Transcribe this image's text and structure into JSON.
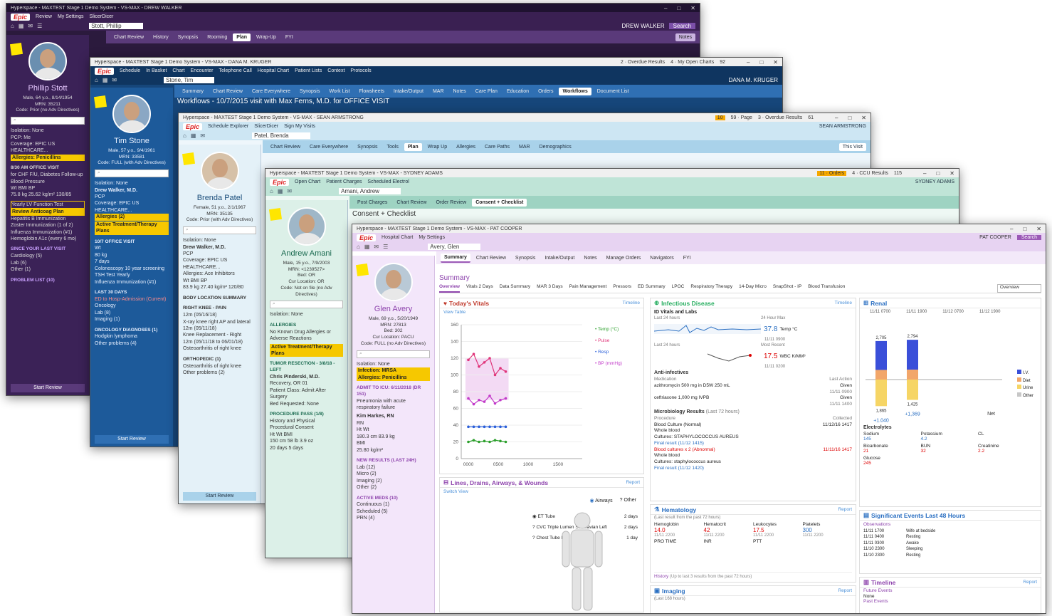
{
  "win1": {
    "title": "Hyperspace - MAXTEST Stage 1 Demo System - VS-MAX - DREW WALKER",
    "menu": [
      "Epic",
      "Review",
      "My Settings",
      "SlicerDicer"
    ],
    "patient_tab": "Stott, Phillip",
    "tabs": [
      "Chart Review",
      "History",
      "Synopsis",
      "Rooming",
      "Plan",
      "Wrap-Up",
      "FYI"
    ],
    "active_tab": "Plan",
    "notes": "Notes",
    "user": "DREW WALKER",
    "search": "Search",
    "patient": {
      "name": "Phillip Stott",
      "info1": "Male, 64 y.o., 8/14/1954",
      "info2": "MRN: 35211",
      "code": "Code: Prior (no Adv Directives)"
    },
    "side_lines": [
      "Isolation: None",
      "PCP: Me",
      "Coverage: EPIC US HEALTHCARE...",
      "Allergies: Penicillins",
      "8/30 AM OFFICE VISIT",
      "for CHF F/U, Diabetes Follow-up",
      "Blood Pressure",
      "Wt    BMI    BP",
      "75.8 kg   25.62 kg/m²   130/85",
      "Yearly LV Function Test",
      "Review Anticoag Plan",
      "Hepatitis B Immunization",
      "Zoster Immunization (1 of 2)",
      "Influenza Immunization (#1)",
      "Hemoglobin A1c (every 6 mo)",
      "SINCE YOUR LAST VISIT",
      "Cardiology (5)",
      "Lab (6)",
      "Other (1)",
      "PROBLEM LIST (10)"
    ],
    "start_review": "Start Review"
  },
  "win2": {
    "title": "Hyperspace - MAXTEST Stage 1 Demo System - VS-MAX - DANA M. KRUGER",
    "alerts": [
      "2 · Overdue Results",
      "4 · My Open Charts",
      "92"
    ],
    "menu": [
      "Epic",
      "Schedule",
      "In Basket",
      "Chart",
      "Encounter",
      "Telephone Call",
      "Hospital Chart",
      "Patient Lists",
      "Context",
      "Protocols"
    ],
    "patient_tab": "Stone, Tim",
    "tabs": [
      "Summary",
      "Chart Review",
      "Care Everywhere",
      "Synopsis",
      "Work List",
      "Flowsheets",
      "Intake/Output",
      "MAR",
      "Notes",
      "Care Plan",
      "Education",
      "Orders",
      "Workflows",
      "Document List"
    ],
    "active_tab": "Workflows",
    "user": "DANA M. KRUGER",
    "banner": "Workflows - 10/7/2015 visit with Max Ferns, M.D. for OFFICE VISIT",
    "patient": {
      "name": "Tim Stone",
      "info1": "Male, 57 y.o., 9/4/1961",
      "info2": "MRN: 33581",
      "code": "Code: FULL (with Adv Directives)"
    },
    "side_lines": [
      "Isolation: None",
      "Drew Walker, M.D.",
      "PCP",
      "Coverage: EPIC US HEALTHCARE...",
      "Allergies (2)",
      "Active Treatment/Therapy Plans",
      "10/7 OFFICE VISIT",
      "Wt",
      "80 kg",
      "7 days",
      "Colonoscopy 10 year screening",
      "TSH Test Yearly",
      "Influenza Immunization (#1)",
      "LAST 30 DAYS",
      "ED to Hosp-Admission (Current)",
      "Oncology",
      "Lab (8)",
      "Imaging (1)",
      "ONCOLOGY DIAGNOSES (1)",
      "Hodgkin lymphoma",
      "Other problems (4)"
    ],
    "start_review": "Start Review"
  },
  "win3": {
    "title": "Hyperspace - MAXTEST Stage 1 Demo System - VS-MAX - SEAN ARMSTRONG",
    "alerts": [
      "10",
      "59 · Page",
      "3 · Overdue Results",
      "61"
    ],
    "menu": [
      "Epic",
      "Schedule Explorer",
      "SlicerDicer",
      "Sign My Visits"
    ],
    "patient_tab": "Patel, Brenda",
    "tabs": [
      "Chart Review",
      "Care Everywhere",
      "Synopsis",
      "Tools",
      "Plan",
      "Wrap Up",
      "Allergies",
      "Care Paths",
      "MAR",
      "Demographics"
    ],
    "active_tab": "Plan",
    "this_visit": "This Visit",
    "user": "SEAN ARMSTRONG",
    "patient": {
      "name": "Brenda Patel",
      "info1": "Female, 51 y.o., 2/1/1967",
      "info2": "MRN: 35135",
      "code": "Code: Prior (with Adv Directives)"
    },
    "side_lines": [
      "Isolation: None",
      "Drew Walker, M.D.",
      "PCP",
      "Coverage: EPIC US HEALTHCARE...",
      "Allergies: Ace Inhibitors",
      "Wt    BMI    BP",
      "83.9 kg   27.40 kg/m²   120/80",
      "BODY LOCATION SUMMARY",
      "RIGHT KNEE - PAIN",
      "12m (05/16/18)",
      "X-ray knee right AP and lateral",
      "12m (05/11/18)",
      "Knee Replacement - Right",
      "12m (05/11/18 to 06/01/18)",
      "Osteoarthritis of right knee",
      "ORTHOPEDIC (1)",
      "Osteoarthritis of right knee",
      "Other problems (2)"
    ],
    "start_review": "Start Review"
  },
  "win4": {
    "title": "Hyperspace - MAXTEST Stage 1 Demo System - VS-MAX - SYDNEY ADAMS",
    "alerts": [
      "11 · Orders",
      "4 · CCU Results",
      "115"
    ],
    "menu": [
      "Epic",
      "Open Chart",
      "Patient Charges",
      "Scheduled Electrol"
    ],
    "patient_tab": "Amani, Andrew",
    "tabs": [
      "Post Charges",
      "Chart Review",
      "Order Review",
      "Consent + Checklist"
    ],
    "active_tab": "Consent + Checklist",
    "banner": "Consent + Checklist",
    "user": "SYDNEY ADAMS",
    "patient": {
      "name": "Andrew Amani",
      "info1": "Male, 15 y.o., 7/9/2003",
      "info2": "MRN: <1239527>",
      "code": "Bed: OR"
    },
    "side_lines": [
      "Cur Location: OR",
      "Code: Not on file (no Adv Directives)",
      "Isolation: None",
      "ALLERGIES",
      "No Known Drug Allergies or Adverse Reactions",
      "Active Treatment/Therapy Plans",
      "TUMOR RESECTION - 3/8/18 - LEFT",
      "Chris Pinderski, M.D.",
      "Recovery, OR 01",
      "Patient Class: Admit After Surgery",
      "Bed Requested: None",
      "PROCEDURE PASS (1/8)",
      "History and Physical",
      "Procedural Consent",
      "Ht    Wt    BMI",
      "150 cm   58 lb 3.9 oz",
      "20 days   5 days"
    ]
  },
  "win5": {
    "title": "Hyperspace - MAXTEST Stage 1 Demo System - VS-MAX - PAT COOPER",
    "menu": [
      "Epic",
      "Hospital Chart",
      "My Settings"
    ],
    "patient_tab": "Avery, Glen",
    "user": "PAT COOPER",
    "search": "Search",
    "tabs": [
      "Summary",
      "Chart Review",
      "Synopsis",
      "Intake/Output",
      "Notes",
      "Manage Orders",
      "Navigators",
      "FYI"
    ],
    "active_tab": "Summary",
    "section_title": "Summary",
    "subtabs": [
      "Overview",
      "Vitals 2 Days",
      "Data Summary",
      "MAR 3 Days",
      "Pain Management",
      "Pressors",
      "ED Summary",
      "LPOC",
      "Respiratory Therapy",
      "14-Day Micro",
      "SnapShot - IP",
      "Blood Transfusion"
    ],
    "active_subtab": "Overview",
    "subtab_dropdown": "Overview",
    "patient": {
      "name": "Glen Avery",
      "info1": "Male, 69 y.o., 5/20/1949",
      "info2": "MRN: 27813",
      "info3": "Bed: 302",
      "info4": "Cur Location: PACU",
      "code": "Code: FULL (no Adv Directives)"
    },
    "side_lines": [
      "Isolation: None",
      "Infection: MRSA",
      "Allergies: Penicillins",
      "ADMIT TO ICU: 6/11/2018 (DR 151)",
      "Pneumonia with acute",
      "respiratory failure",
      "Kim Harkes, RN",
      "RN",
      "Ht    Wt",
      "180.3 cm   83.9 kg",
      "BMI",
      "25.80 kg/m²",
      "NEW RESULTS (LAST 24H)",
      "Lab (12)",
      "Micro (2)",
      "Imaging (2)",
      "Other (2)",
      "ACTIVE MEDS (10)",
      "Continuous (1)",
      "Scheduled (5)",
      "PRN (4)"
    ],
    "vitals": {
      "title": "Today's Vitals",
      "link": "View Table",
      "report": "Timeline",
      "legend": [
        "Temp (°C)",
        "Pulse",
        "Resp",
        "BP (mmHg)"
      ]
    },
    "lines": {
      "title": "Lines, Drains, Airways, & Wounds",
      "report": "Report",
      "link": "Switch View",
      "filters": [
        "Airways",
        "Other"
      ],
      "items": [
        [
          "ET Tube",
          "2 days"
        ],
        [
          "CVC Triple Lumen Subclavian Left",
          "2 days"
        ],
        [
          "Chest Tube Left",
          "1 day"
        ]
      ]
    },
    "infectious": {
      "title": "Infectious Disease",
      "report": "Timeline",
      "sub1": "ID Vitals and Labs",
      "temp_label": "Last 24 hours",
      "temp_max": "24 Hour Max",
      "temp_val": "37.8",
      "temp_name": "Temp °C",
      "temp_date": "11/11 0900",
      "wbc_label": "Last 24 hours",
      "wbc_recent": "Most Recent",
      "wbc_val": "17.5",
      "wbc_name": "WBC K/MM³",
      "wbc_date": "11/11 0200",
      "anti_title": "Anti-infectives",
      "anti_hdr": [
        "Medication",
        "Last Action"
      ],
      "anti": [
        [
          "azithromycin 500 mg in D5W 250 mL",
          "Given",
          "11/11 0900"
        ],
        [
          "ceftriaxone 1,000 mg IVPB",
          "Given",
          "11/11 1400"
        ]
      ],
      "micro_title": "Microbiology Results",
      "micro_sub": "(Last 72 hours)",
      "micro_hdr": [
        "Procedure",
        "Collected"
      ],
      "micro": [
        "Blood Culture (Normal)",
        "Whole blood",
        "Cultures: STAPHYLOCOCCUS AUREUS",
        "Final result (11/12 1415)",
        "Blood cultures x 2 (Abnormal)",
        "Whole blood",
        "Cultures: staphylococcus aureus",
        "Final result (11/12 1420)"
      ],
      "micro_dates": [
        "11/12/16 1417",
        "11/11/16 1417"
      ]
    },
    "hematology": {
      "title": "Hematology",
      "report": "Report",
      "sub": "(Last result from the past 72 hours)",
      "cols": [
        [
          "Hemoglobin",
          "14.0",
          "11/11 2200"
        ],
        [
          "Hematocrit",
          "42",
          "11/11 2200"
        ],
        [
          "Leukocytes",
          "17.5",
          "11/11 2200"
        ],
        [
          "Platelets",
          "300",
          "11/11 2200"
        ]
      ],
      "cols2": [
        "PRO TIME",
        "INR",
        "PTT"
      ],
      "history": "History",
      "history_sub": "(Up to last 3 results from the past 72 hours)"
    },
    "imaging": {
      "title": "Imaging",
      "report": "Report",
      "sub": "(Last 168 hours)"
    },
    "renal": {
      "title": "Renal",
      "times": [
        "11/11 0700",
        "11/11 1900",
        "11/12 0700",
        "11/12 1900"
      ],
      "bars": [
        {
          "in": 2705,
          "out": 1865,
          "net": 1040
        },
        {
          "in": 2794,
          "out": 1425,
          "net": 1369
        }
      ],
      "net_label": "Net",
      "legend": [
        "I.V.",
        "Diet",
        "Urine",
        "Other"
      ],
      "elec_title": "Electrolytes",
      "elec": [
        [
          "Sodium",
          "145",
          ""
        ],
        [
          "Potassium",
          "4.2",
          ""
        ],
        [
          "CL",
          "",
          ""
        ],
        [
          "Bicarbonate",
          "21",
          "red"
        ],
        [
          "BUN",
          "32",
          "red"
        ],
        [
          "Creatinine",
          "2.2",
          "red"
        ],
        [
          "Glucose",
          "245",
          "red"
        ]
      ]
    },
    "events": {
      "title": "Significant Events Last 48 Hours",
      "sub": "Observations",
      "rows": [
        [
          "11/11 1700",
          "Wife at bedside"
        ],
        [
          "11/11 0400",
          "Resting"
        ],
        [
          "11/11 0300",
          "Awake"
        ],
        [
          "11/10 2300",
          "Sleeping"
        ],
        [
          "11/10 2300",
          "Resting"
        ]
      ]
    },
    "timeline": {
      "title": "Timeline",
      "report": "Report",
      "sub": "Future Events",
      "none": "None",
      "past": "Past Events"
    }
  },
  "chart_data": {
    "type": "line",
    "title": "Today's Vitals",
    "x": [
      "0000",
      "0500",
      "1000",
      "1500"
    ],
    "ylim": [
      0,
      160
    ],
    "yticks": [
      0,
      20,
      40,
      60,
      80,
      100,
      120,
      140,
      160
    ],
    "series": [
      {
        "name": "Pulse",
        "color": "#e0357a",
        "values": [
          [
            1,
            118
          ],
          [
            2,
            125
          ],
          [
            3,
            110
          ],
          [
            4,
            115
          ],
          [
            5,
            120
          ],
          [
            6,
            100
          ],
          [
            7,
            108
          ],
          [
            8,
            104
          ]
        ]
      },
      {
        "name": "BP (mmHg)",
        "color": "#c23ac9",
        "values": [
          [
            1,
            72
          ],
          [
            2,
            65
          ],
          [
            3,
            70
          ],
          [
            4,
            68
          ],
          [
            5,
            75
          ],
          [
            6,
            66
          ],
          [
            7,
            70
          ],
          [
            8,
            72
          ]
        ]
      },
      {
        "name": "Resp",
        "color": "#2a5fd9",
        "values": [
          [
            1,
            38
          ],
          [
            2,
            38
          ],
          [
            3,
            38
          ],
          [
            4,
            38
          ],
          [
            5,
            38
          ],
          [
            6,
            38
          ],
          [
            7,
            38
          ],
          [
            8,
            38
          ]
        ]
      },
      {
        "name": "Temp (°C)",
        "color": "#2ca02c",
        "values": [
          [
            1,
            20
          ],
          [
            2,
            22
          ],
          [
            3,
            20
          ],
          [
            4,
            21
          ],
          [
            5,
            20
          ],
          [
            6,
            22
          ],
          [
            7,
            21
          ],
          [
            8,
            20
          ]
        ]
      }
    ]
  },
  "colors": {
    "w1": "#2b1a3d",
    "w1side": "#3b2257",
    "w2": "#16467a",
    "w2side": "#1d5a9a",
    "w3": "#cde6f3",
    "w4": "#bfe4d7",
    "w5": "#efe2f7",
    "purple": "#9b59b6"
  }
}
